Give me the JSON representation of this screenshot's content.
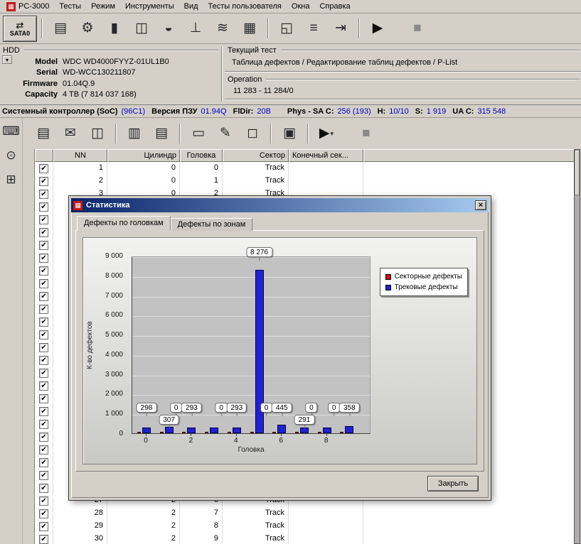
{
  "icons": {
    "close": "×",
    "caret": "▾",
    "check": "✔",
    "logo": "▦",
    "hdd_dropdown": "▾"
  },
  "menu": {
    "items": [
      {
        "id": "pc3000",
        "label": "PC-3000"
      },
      {
        "id": "tests",
        "label": "Тесты"
      },
      {
        "id": "mode",
        "label": "Режим"
      },
      {
        "id": "tools",
        "label": "Инструменты"
      },
      {
        "id": "view",
        "label": "Вид"
      },
      {
        "id": "user-tests",
        "label": "Тесты пользователя"
      },
      {
        "id": "windows",
        "label": "Окна"
      },
      {
        "id": "help",
        "label": "Справка"
      }
    ]
  },
  "toolbar": {
    "sata_label": "SATA0"
  },
  "main_toolbar": {
    "icons": [
      {
        "sep": true
      },
      {
        "name": "test-selection-icon",
        "glyph": "▤"
      },
      {
        "name": "gears-icon",
        "glyph": "⚙"
      },
      {
        "name": "database-icon",
        "glyph": "▮"
      },
      {
        "name": "rom-icon",
        "glyph": "◫"
      },
      {
        "name": "export-icon",
        "glyph": "◒"
      },
      {
        "name": "oscilloscope-icon",
        "glyph": "⊥"
      },
      {
        "name": "waveform-icon",
        "glyph": "≋"
      },
      {
        "name": "sector-grid-icon",
        "glyph": "▦"
      },
      {
        "sep": true
      },
      {
        "name": "copy-icon",
        "glyph": "◱"
      },
      {
        "name": "disk-stack-icon",
        "glyph": "≡"
      },
      {
        "name": "exit-icon",
        "glyph": "⇥"
      },
      {
        "sep": true
      },
      {
        "name": "start-test-icon",
        "glyph": "▶",
        "color": "#101010"
      },
      {
        "gap": true
      },
      {
        "name": "stop-test-icon",
        "glyph": "■",
        "color": "#8a8a8a"
      }
    ]
  },
  "defect_toolbar": {
    "icons": [
      {
        "name": "defect-table-icon",
        "glyph": "▤"
      },
      {
        "name": "open-icon",
        "glyph": "✉"
      },
      {
        "name": "save-icon",
        "glyph": "◫"
      },
      {
        "sep": true
      },
      {
        "name": "report-icon",
        "glyph": "▥"
      },
      {
        "name": "print-icon",
        "glyph": "▤"
      },
      {
        "sep": true
      },
      {
        "name": "add-record-icon",
        "glyph": "▭"
      },
      {
        "name": "edit-record-icon",
        "glyph": "✎"
      },
      {
        "name": "clear-record-icon",
        "glyph": "◻"
      },
      {
        "sep": true
      },
      {
        "name": "convert-icon",
        "glyph": "▣"
      },
      {
        "sep": true
      },
      {
        "name": "start-edit-icon",
        "glyph": "▶",
        "color": "#101010",
        "caret": true
      },
      {
        "gap": true
      },
      {
        "name": "stop-edit-icon",
        "glyph": "■",
        "color": "#8a8a8a"
      }
    ]
  },
  "sidebar": {
    "icons": [
      {
        "name": "sidebar-terminal-icon",
        "glyph": "⌨"
      },
      {
        "name": "sidebar-search-icon",
        "glyph": "⊙"
      },
      {
        "name": "sidebar-defect-grid-icon",
        "glyph": "⊞"
      }
    ]
  },
  "hdd": {
    "panel_label": "HDD",
    "fields": [
      {
        "label": "Model",
        "value": "WDC WD4000FYYZ-01UL1B0"
      },
      {
        "label": "Serial",
        "value": "WD-WCC130211807"
      },
      {
        "label": "Firmware",
        "value": "01.04Q.9"
      },
      {
        "label": "Capacity",
        "value": "4 TB (7 814 037 168)"
      }
    ]
  },
  "current_test": {
    "group_label": "Текущий тест",
    "test_name": "Таблица дефектов / Редактирование таблиц дефектов / P-List",
    "operation_label": "Operation",
    "operation_value": "11 283 - 11 284/0"
  },
  "status_line": {
    "segments": [
      {
        "label": "Системный контроллер (SoC)",
        "value": "(96C1)"
      },
      {
        "label": "Версия ПЗУ",
        "value": "01.94Q"
      },
      {
        "label": "FlDir:",
        "value": "20B"
      },
      {
        "label": "Phys - SA C:",
        "value": "256 (193)",
        "gap": true
      },
      {
        "label": "H:",
        "value": "10/10"
      },
      {
        "label": "S:",
        "value": "1 919"
      },
      {
        "label": "UA C:",
        "value": "315 548"
      }
    ]
  },
  "table": {
    "columns": [
      "NN",
      "Цилиндр",
      "Головка",
      "Сектор",
      "Конечный сек..."
    ],
    "rows_total": 30,
    "all_checked": true,
    "visible_rows": {
      "1": [
        "1",
        "0",
        "0",
        "Track",
        ""
      ],
      "2": [
        "2",
        "0",
        "1",
        "Track",
        ""
      ],
      "3": [
        "3",
        "0",
        "2",
        "Track",
        ""
      ],
      "27": [
        "27",
        "2",
        "6",
        "Track",
        ""
      ],
      "28": [
        "28",
        "2",
        "7",
        "Track",
        ""
      ],
      "29": [
        "29",
        "2",
        "8",
        "Track",
        ""
      ],
      "30": [
        "30",
        "2",
        "9",
        "Track",
        ""
      ]
    }
  },
  "dialog": {
    "title": "Статистика",
    "tabs": [
      {
        "label": "Дефекты по головкам",
        "active": true
      },
      {
        "label": "Дефекты по зонам",
        "active": false
      }
    ],
    "close_label": "Закрыть"
  },
  "chart_data": {
    "type": "bar",
    "title": "",
    "xlabel": "Головка",
    "ylabel": "К-во дефектов",
    "ylim": [
      0,
      9000
    ],
    "ytick_step": 1000,
    "ytick_labels": [
      "0",
      "1 000",
      "2 000",
      "3 000",
      "4 000",
      "5 000",
      "6 000",
      "7 000",
      "8 000",
      "9 000"
    ],
    "categories": [
      0,
      1,
      2,
      3,
      4,
      5,
      6,
      7,
      8,
      9
    ],
    "xtick_labels": [
      0,
      2,
      4,
      6,
      8
    ],
    "grid": true,
    "legend_position": "top-right",
    "series": [
      {
        "name": "Секторные дефекты",
        "color": "#cc1111",
        "values": [
          0,
          0,
          0,
          0,
          0,
          0,
          0,
          0,
          0,
          0
        ]
      },
      {
        "name": "Трековые дефекты",
        "color": "#2222cc",
        "values": [
          298,
          307,
          293,
          293,
          293,
          8276,
          445,
          291,
          300,
          358
        ]
      }
    ],
    "callouts": [
      {
        "head": 0,
        "text": "298",
        "row": "high",
        "dx": 0
      },
      {
        "head": 1,
        "text": "0",
        "row": "high",
        "dx": 10
      },
      {
        "head": 1,
        "text": "307",
        "row": "low",
        "dx": 0
      },
      {
        "head": 2,
        "text": "293",
        "row": "high",
        "dx": 0
      },
      {
        "head": 3,
        "text": "0",
        "row": "high",
        "dx": 10
      },
      {
        "head": 4,
        "text": "293",
        "row": "high",
        "dx": 0
      },
      {
        "head": 5,
        "text": "8 276",
        "row": "top",
        "dx": 0
      },
      {
        "head": 5,
        "text": "0",
        "row": "high",
        "dx": 10
      },
      {
        "head": 6,
        "text": "445",
        "row": "high",
        "dx": 0
      },
      {
        "head": 7,
        "text": "0",
        "row": "high",
        "dx": 10
      },
      {
        "head": 7,
        "text": "291",
        "row": "low",
        "dx": 0
      },
      {
        "head": 8,
        "text": "0",
        "row": "high",
        "dx": 10
      },
      {
        "head": 9,
        "text": "358",
        "row": "high",
        "dx": 0
      }
    ]
  }
}
